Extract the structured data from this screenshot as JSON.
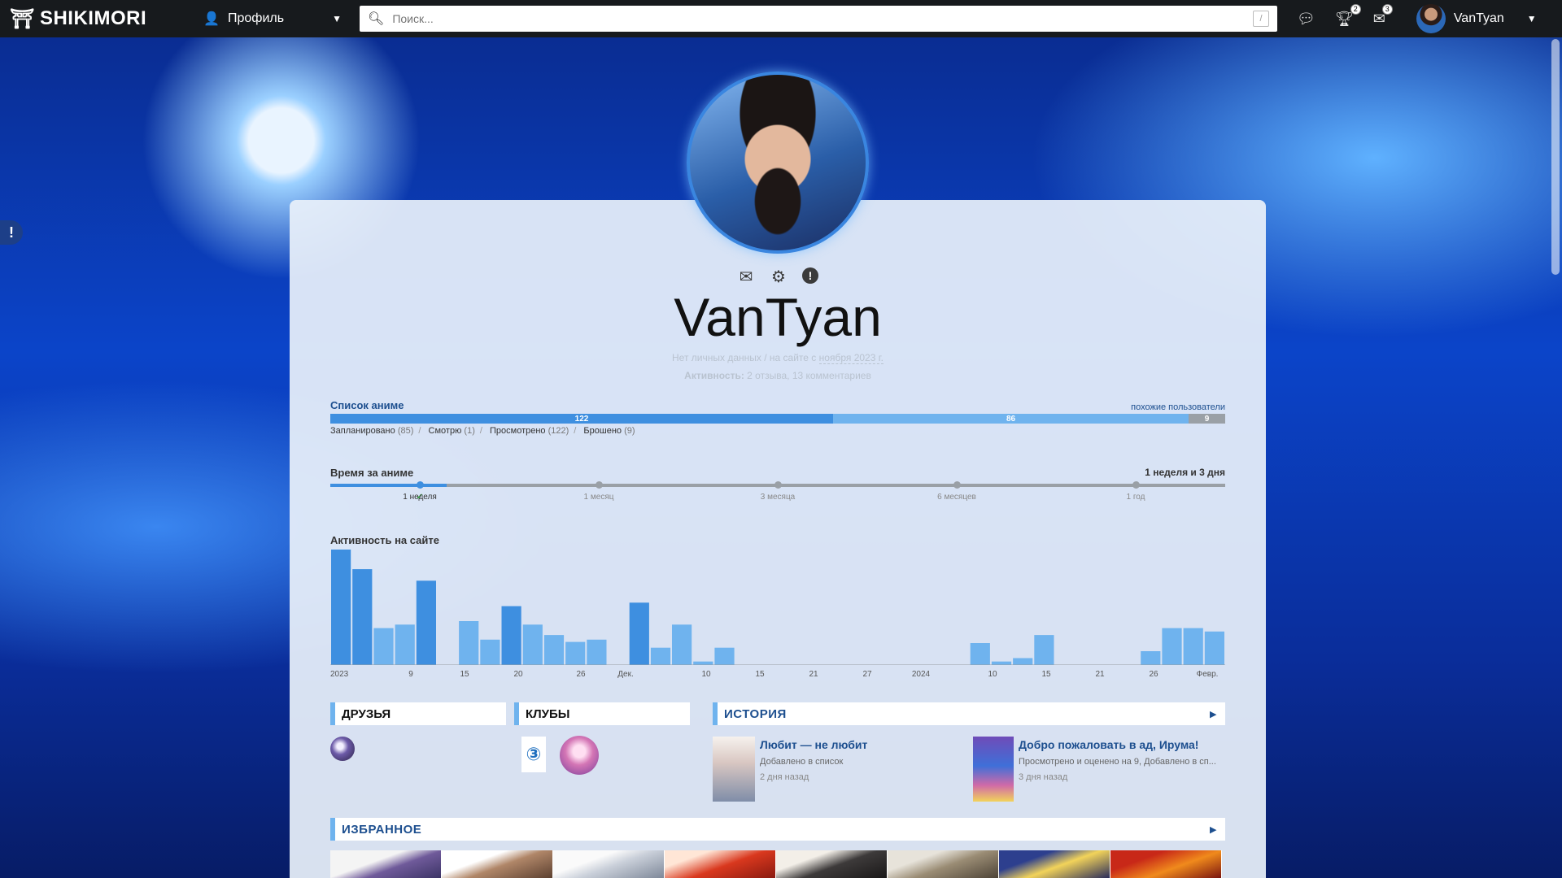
{
  "topbar": {
    "logo": "SHIKIMORI",
    "profile_menu_label": "Профиль",
    "search_placeholder": "Поиск...",
    "search_hotkey": "/",
    "forum_badge": "",
    "achievements_badge": "2",
    "messages_badge": "3",
    "username": "VanTyan"
  },
  "profile": {
    "nickname": "VanTyan",
    "no_personal_data": "Нет личных данных",
    "separator": "/",
    "on_site_since_prefix": "на сайте с",
    "on_site_since_date": "ноября 2023 г.",
    "activity_label": "Активность:",
    "reviews": "2 отзыва",
    "comments": "13 комментариев"
  },
  "anime_list": {
    "title": "Список аниме",
    "similar_users_link": "похожие пользователи",
    "bar": [
      {
        "key": "watched",
        "value": "122"
      },
      {
        "key": "planned",
        "value": "86"
      },
      {
        "key": "dropped",
        "value": "9"
      }
    ],
    "legend": [
      {
        "label": "Запланировано",
        "count": "85"
      },
      {
        "label": "Смотрю",
        "count": "1"
      },
      {
        "label": "Просмотрено",
        "count": "122"
      },
      {
        "label": "Брошено",
        "count": "9"
      }
    ]
  },
  "anime_time": {
    "title": "Время за аниме",
    "total": "1 неделя и 3 дня",
    "progress_fraction": 0.13,
    "marks": [
      {
        "label": "1 неделя",
        "active": true
      },
      {
        "label": "1 месяц",
        "active": false
      },
      {
        "label": "3 месяца",
        "active": false
      },
      {
        "label": "6 месяцев",
        "active": false
      },
      {
        "label": "1 год",
        "active": false
      }
    ]
  },
  "chart_data": {
    "type": "bar",
    "title": "Активность на сайте",
    "x_tick_labels": [
      "2023",
      "9",
      "15",
      "20",
      "26",
      "Дек.",
      "10",
      "15",
      "21",
      "27",
      "2024",
      "10",
      "15",
      "21",
      "26",
      "Февр."
    ],
    "values": [
      100,
      83,
      32,
      35,
      73,
      0,
      38,
      22,
      51,
      35,
      26,
      20,
      22,
      0,
      54,
      15,
      35,
      3,
      15,
      0,
      0,
      0,
      0,
      0,
      0,
      0,
      0,
      0,
      0,
      0,
      19,
      3,
      6,
      26,
      0,
      0,
      0,
      0,
      12,
      32,
      32,
      29
    ],
    "ylim": [
      0,
      100
    ],
    "colors": {
      "dark": "#3e8fe0",
      "light": "#6fb3ee"
    }
  },
  "blocks": {
    "friends": "ДРУЗЬЯ",
    "clubs": "КЛУБЫ",
    "history": "ИСТОРИЯ",
    "favorites": "ИЗБРАННОЕ",
    "club_css_icon": "css3-icon"
  },
  "history": [
    {
      "title": "Любит — не любит",
      "desc": "Добавлено в список",
      "time": "2 дня назад"
    },
    {
      "title": "Добро пожаловать в ад, Ирума!",
      "desc": "Просмотрено и оценено на 9, Добавлено в сп...",
      "time": "3 дня назад"
    }
  ],
  "colors": {
    "accent": "#3e8fe0",
    "accent_light": "#6fb3ee",
    "link": "#1d4f8f",
    "topbar": "#171a1d"
  }
}
